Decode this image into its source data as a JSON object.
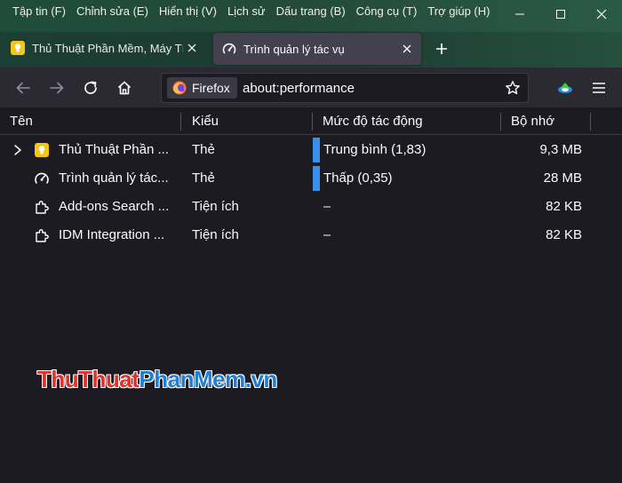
{
  "menubar": {
    "items": [
      "Tập tin (F)",
      "Chỉnh sửa (E)",
      "Hiển thị (V)",
      "Lịch sử",
      "Dấu trang (B)",
      "Công cụ (T)",
      "Trợ giúp (H)"
    ]
  },
  "tabs": [
    {
      "label": "Thủ Thuật Phần Mềm, Máy Tính,",
      "icon": "bulb-icon"
    },
    {
      "label": "Trình quản lý tác vụ",
      "icon": "gauge-icon"
    }
  ],
  "urlbar": {
    "identity": "Firefox",
    "url": "about:performance"
  },
  "table": {
    "headers": [
      "Tên",
      "Kiểu",
      "Mức độ tác động",
      "Bộ nhớ"
    ],
    "rows": [
      {
        "name": "Thủ Thuật Phần ...",
        "type": "Thẻ",
        "impact": "Trung bình (1,83)",
        "memory": "9,3 MB",
        "icon": "bulb-icon",
        "expandable": true
      },
      {
        "name": "Trình quản lý tác...",
        "type": "Thẻ",
        "impact": "Thấp (0,35)",
        "memory": "28 MB",
        "icon": "gauge-icon",
        "expandable": false
      },
      {
        "name": "Add-ons Search ...",
        "type": "Tiện ích",
        "impact": "–",
        "memory": "82 KB",
        "icon": "puzzle-icon",
        "expandable": false
      },
      {
        "name": "IDM Integration ...",
        "type": "Tiện ích",
        "impact": "–",
        "memory": "82 KB",
        "icon": "puzzle-icon",
        "expandable": false
      }
    ]
  },
  "watermark": {
    "part1": "Thu",
    "part2": "Thuat",
    "part3": "PhanMem",
    "part4": ".vn"
  },
  "colors": {
    "impact_bar": "#3a8fe8",
    "bulb": "#f5c518",
    "background": "#1c1b22"
  }
}
